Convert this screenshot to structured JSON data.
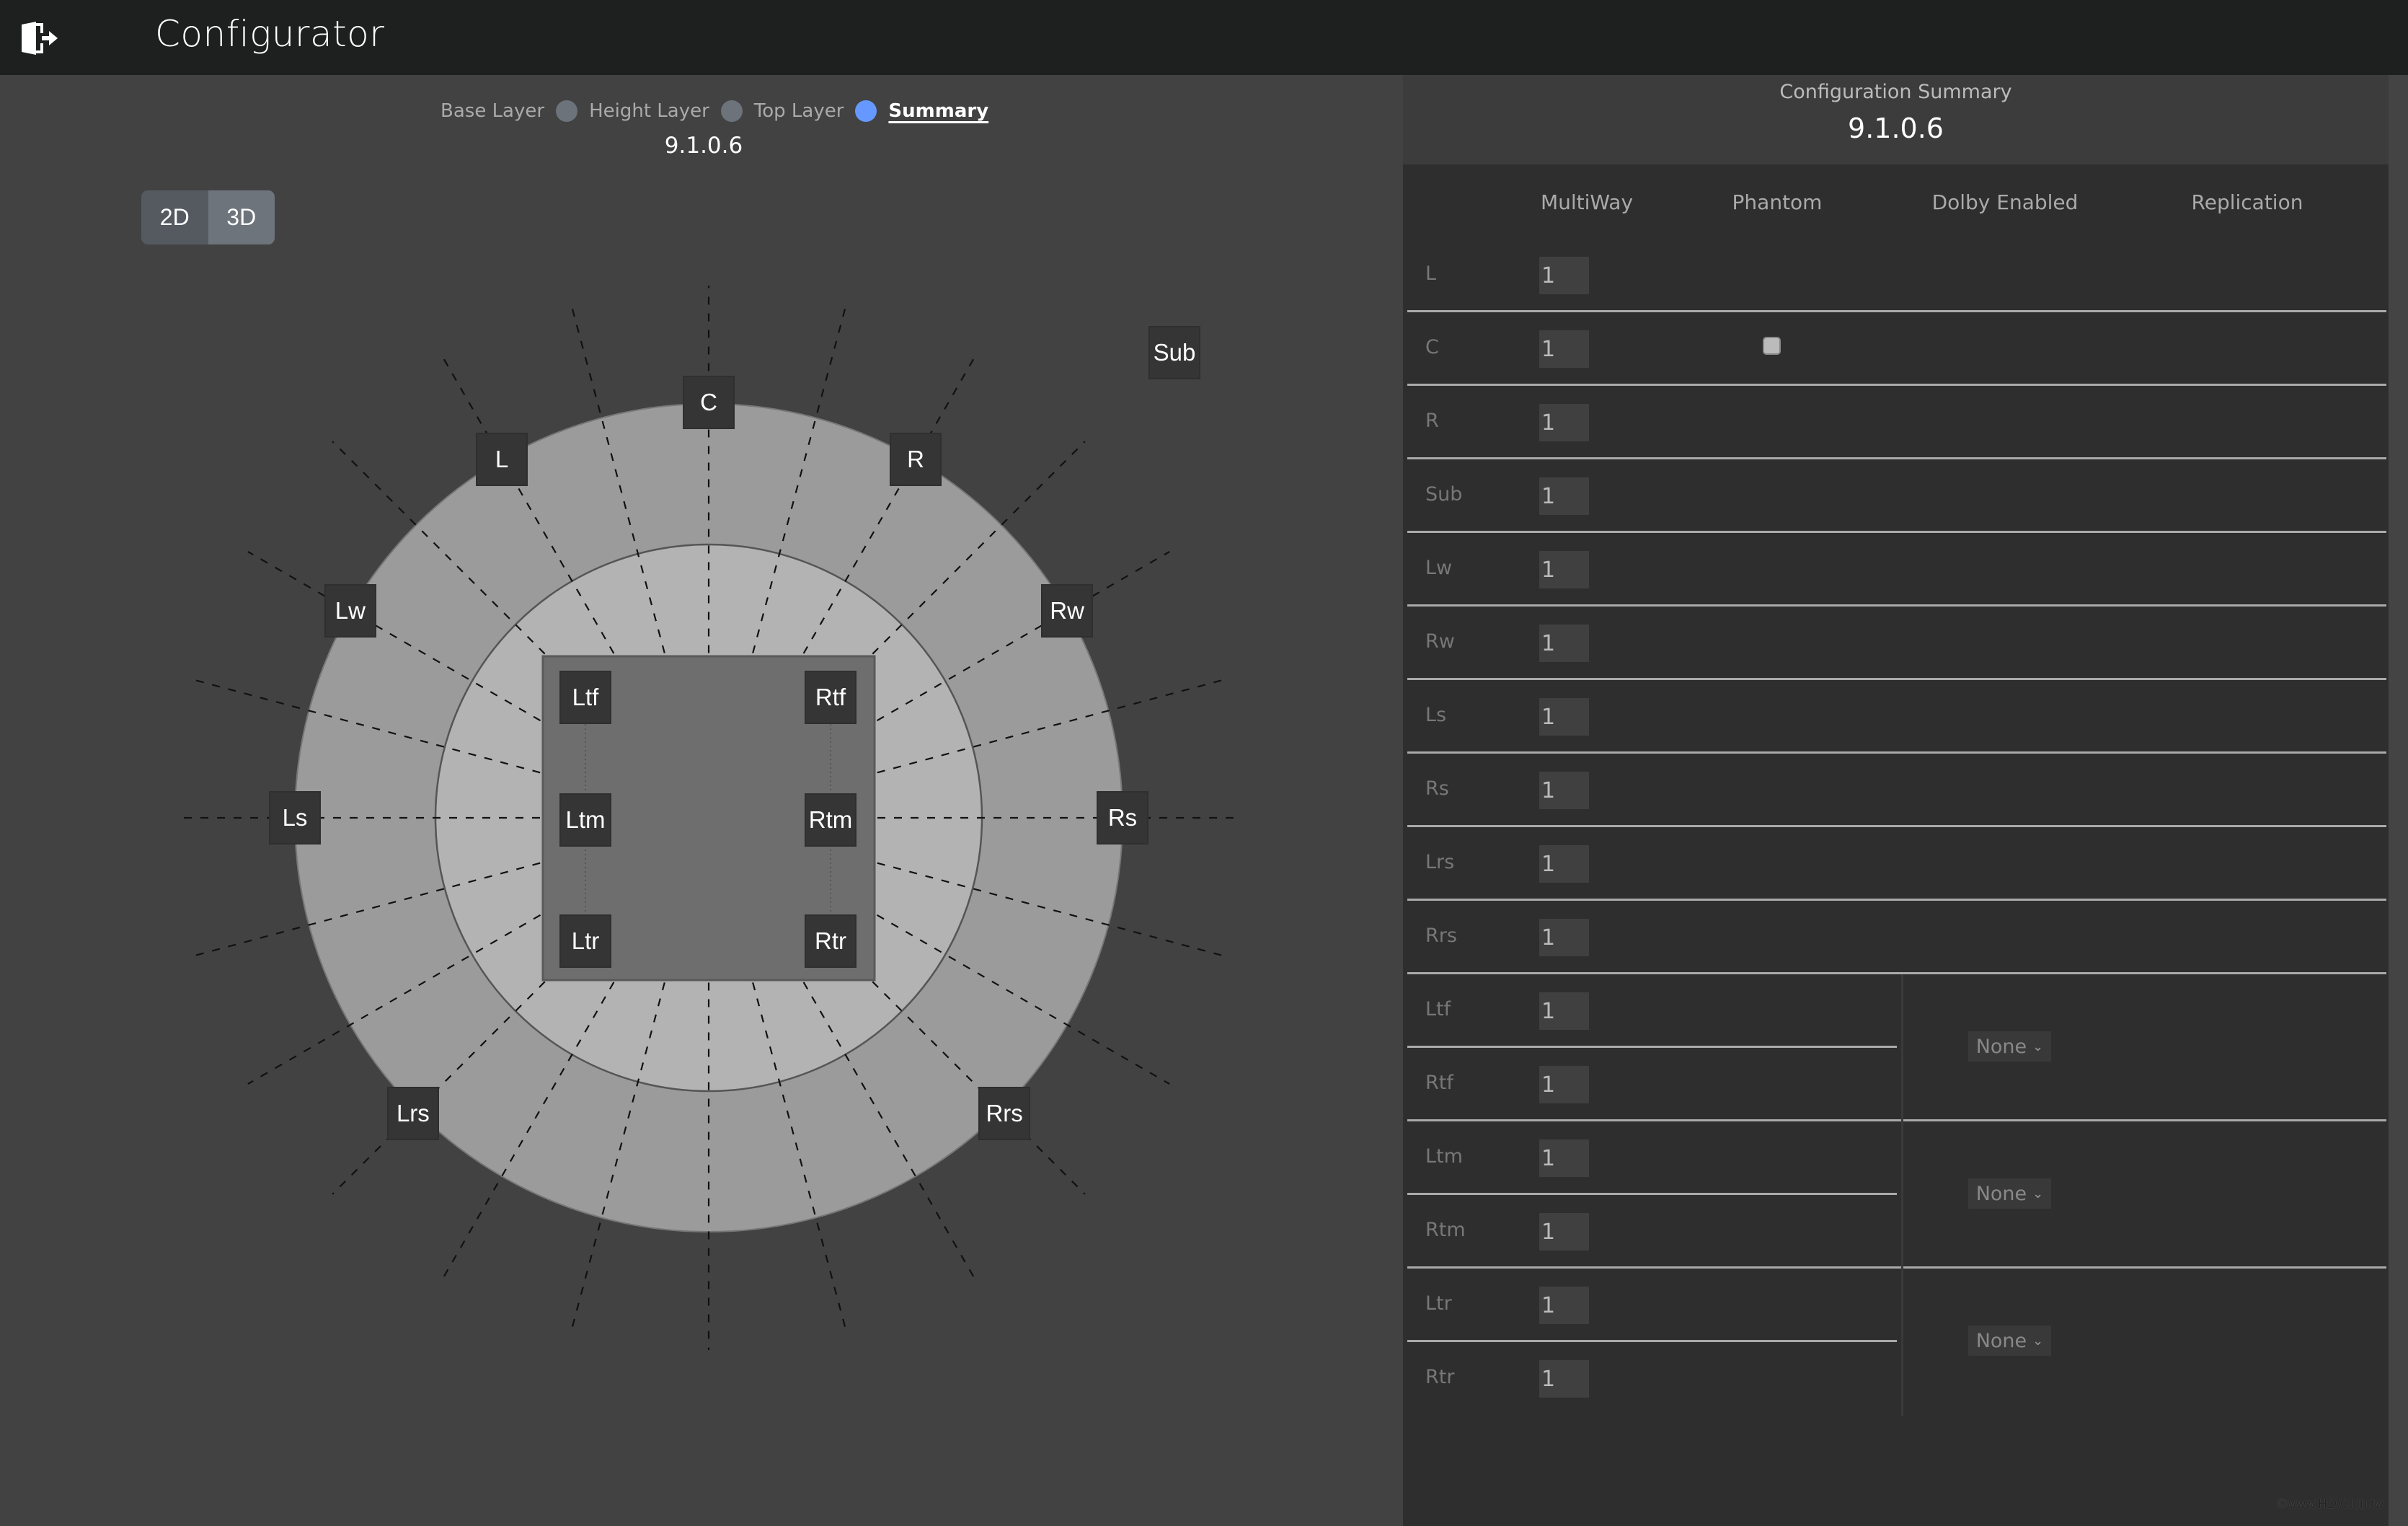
{
  "app": {
    "title": "Configurator",
    "logo_icon": "exit-door-icon"
  },
  "layers": {
    "items": [
      {
        "label": "Base Layer",
        "active": false
      },
      {
        "label": "Height Layer",
        "active": false
      },
      {
        "label": "Top Layer",
        "active": false
      },
      {
        "label": "Summary",
        "active": true
      }
    ],
    "version": "9.1.0.6",
    "colors": {
      "inactive_dot": "#6d737a",
      "active_dot": "#6699ff"
    }
  },
  "view_toggle": {
    "options": [
      "2D",
      "3D"
    ],
    "selected": "3D"
  },
  "diagram": {
    "speakers": [
      {
        "id": "C",
        "label": "C",
        "angle_deg": 0,
        "ring": "outer"
      },
      {
        "id": "L",
        "label": "L",
        "angle_deg": -30,
        "ring": "outer"
      },
      {
        "id": "R",
        "label": "R",
        "angle_deg": 30,
        "ring": "outer"
      },
      {
        "id": "Lw",
        "label": "Lw",
        "angle_deg": -60,
        "ring": "outer"
      },
      {
        "id": "Rw",
        "label": "Rw",
        "angle_deg": 60,
        "ring": "outer"
      },
      {
        "id": "Ls",
        "label": "Ls",
        "angle_deg": -90,
        "ring": "outer"
      },
      {
        "id": "Rs",
        "label": "Rs",
        "angle_deg": 90,
        "ring": "outer"
      },
      {
        "id": "Lrs",
        "label": "Lrs",
        "angle_deg": -135,
        "ring": "outer"
      },
      {
        "id": "Rrs",
        "label": "Rrs",
        "angle_deg": 135,
        "ring": "outer"
      }
    ],
    "height_speakers": [
      {
        "id": "Ltf",
        "label": "Ltf",
        "side": "left",
        "row": "front"
      },
      {
        "id": "Rtf",
        "label": "Rtf",
        "side": "right",
        "row": "front"
      },
      {
        "id": "Ltm",
        "label": "Ltm",
        "side": "left",
        "row": "middle"
      },
      {
        "id": "Rtm",
        "label": "Rtm",
        "side": "right",
        "row": "middle"
      },
      {
        "id": "Ltr",
        "label": "Ltr",
        "side": "left",
        "row": "rear"
      },
      {
        "id": "Rtr",
        "label": "Rtr",
        "side": "right",
        "row": "rear"
      }
    ],
    "sub": {
      "label": "Sub"
    },
    "ray_step_deg": 15
  },
  "summary": {
    "title": "Configuration Summary",
    "version": "9.1.0.6",
    "columns": [
      "MultiWay",
      "Phantom",
      "Dolby Enabled",
      "Replication"
    ],
    "rows": [
      {
        "label": "L",
        "multiway": "1"
      },
      {
        "label": "C",
        "multiway": "1",
        "phantom": true
      },
      {
        "label": "R",
        "multiway": "1"
      },
      {
        "label": "Sub",
        "multiway": "1"
      },
      {
        "label": "Lw",
        "multiway": "1"
      },
      {
        "label": "Rw",
        "multiway": "1"
      },
      {
        "label": "Ls",
        "multiway": "1"
      },
      {
        "label": "Rs",
        "multiway": "1"
      },
      {
        "label": "Lrs",
        "multiway": "1"
      },
      {
        "label": "Rrs",
        "multiway": "1"
      },
      {
        "label": "Ltf",
        "multiway": "1"
      },
      {
        "label": "Rtf",
        "multiway": "1"
      },
      {
        "label": "Ltm",
        "multiway": "1"
      },
      {
        "label": "Rtm",
        "multiway": "1"
      },
      {
        "label": "Ltr",
        "multiway": "1"
      },
      {
        "label": "Rtr",
        "multiway": "1"
      }
    ],
    "dolby_enabled_pairs": [
      {
        "pair": "Ltf/Rtf",
        "value": "None"
      },
      {
        "pair": "Ltm/Rtm",
        "value": "None"
      },
      {
        "pair": "Ltr/Rtr",
        "value": "None"
      }
    ]
  },
  "watermark": "©www.HD.Club.tw"
}
